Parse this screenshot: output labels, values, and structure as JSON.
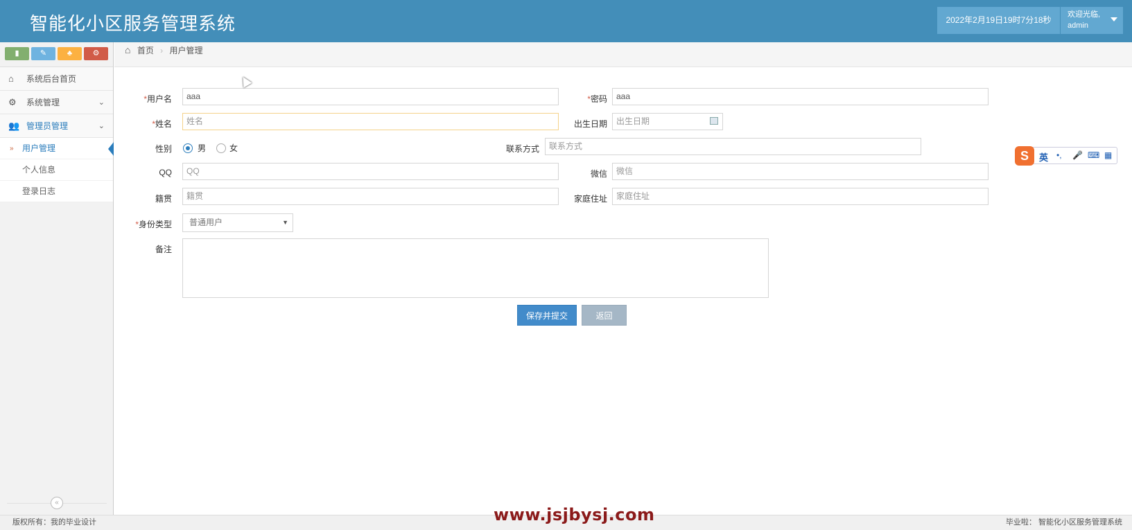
{
  "header": {
    "title": "智能化小区服务管理系统",
    "datetime": "2022年2月19日19时7分18秒",
    "welcome": "欢迎光临,",
    "username": "admin"
  },
  "sidebar": {
    "shortcut_icons": [
      "signal-icon",
      "pencil-icon",
      "users-icon",
      "cogs-icon"
    ],
    "items": [
      {
        "label": "系统后台首页",
        "icon": "home-icon"
      },
      {
        "label": "系统管理",
        "icon": "cogs-icon"
      },
      {
        "label": "管理员管理",
        "icon": "users-icon"
      }
    ],
    "sub_items": [
      {
        "label": "用户管理",
        "active": true
      },
      {
        "label": "个人信息"
      },
      {
        "label": "登录日志"
      }
    ]
  },
  "breadcrumb": {
    "home": "首页",
    "current": "用户管理"
  },
  "form": {
    "username": {
      "label": "用户名",
      "value": "aaa",
      "required": true
    },
    "password": {
      "label": "密码",
      "value": "aaa",
      "required": true
    },
    "name": {
      "label": "姓名",
      "placeholder": "姓名",
      "required": true
    },
    "birthday": {
      "label": "出生日期",
      "placeholder": "出生日期"
    },
    "gender": {
      "label": "性别",
      "options": [
        "男",
        "女"
      ],
      "selected": "男"
    },
    "contact": {
      "label": "联系方式",
      "placeholder": "联系方式"
    },
    "qq": {
      "label": "QQ",
      "placeholder": "QQ"
    },
    "wechat": {
      "label": "微信",
      "placeholder": "微信"
    },
    "native_place": {
      "label": "籍贯",
      "placeholder": "籍贯"
    },
    "address": {
      "label": "家庭住址",
      "placeholder": "家庭住址"
    },
    "identity": {
      "label": "身份类型",
      "selected": "普通用户",
      "required": true
    },
    "remark": {
      "label": "备注"
    },
    "submit_label": "保存并提交",
    "back_label": "返回"
  },
  "ime": {
    "mode": "英"
  },
  "footer": {
    "copyright": "版权所有：我的毕业设计",
    "site": "毕业啦：  智能化小区服务管理系统",
    "watermark": "www.jsjbysj.com"
  },
  "colors": {
    "header_bg": "#438eb9",
    "accent": "#2b7dbc",
    "required": "#d15b47",
    "watermark": "#8b1a1a"
  }
}
